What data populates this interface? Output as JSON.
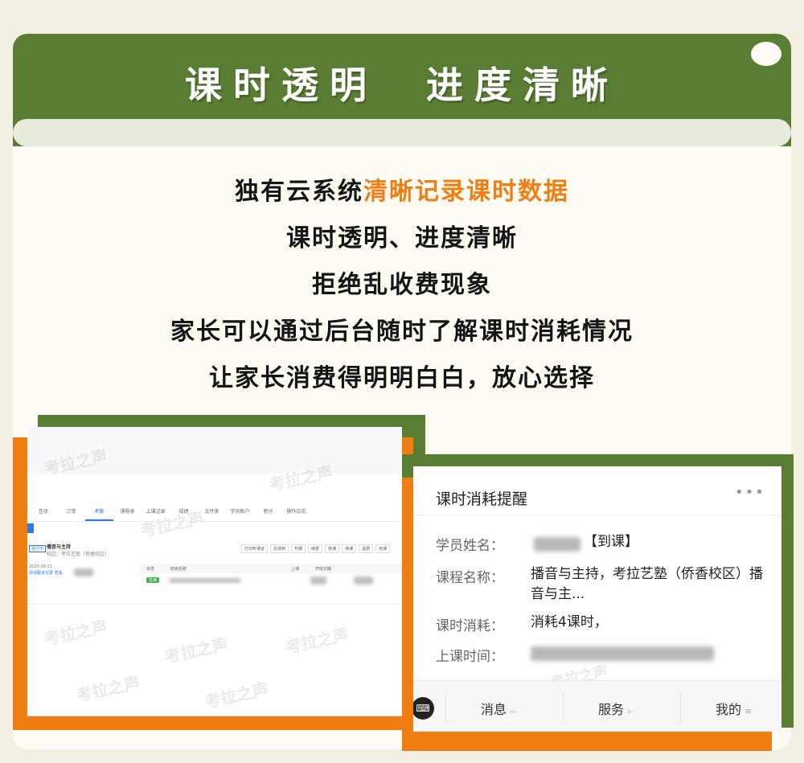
{
  "header": {
    "title": "课时透明  进度清晰"
  },
  "intro": {
    "line1_a": "独有云系统",
    "line1_b": "清晰记录课时数据",
    "line2": "课时透明、进度清晰",
    "line3": "拒绝乱收费现象",
    "line4": "家长可以通过后台随时了解课时消耗情况",
    "line5": "让家长消费得明明白白，放心选择"
  },
  "colors": {
    "brand_green": "#5a7d34",
    "accent_orange": "#f07e12",
    "background": "#f4efe3"
  },
  "watermark": {
    "text": "考拉之声"
  },
  "admin_screenshot": {
    "tabs": [
      "互动",
      "订单",
      "考勤",
      "课程表",
      "上课记录",
      "成绩",
      "文件夹",
      "学员账户",
      "积分",
      "操作日志"
    ],
    "course_title": "播音与主持",
    "course_sub": "校区：考拉艺塾（侨香校区）",
    "status_tag": "进行中",
    "buttons": [
      "打印听课证",
      "反馈到",
      "升期",
      "续费",
      "转课",
      "停课",
      "退费",
      "结课"
    ],
    "table_headers": [
      "状态",
      "班级名称",
      "上课",
      "开班日期"
    ],
    "row_status": "在读",
    "left_info": "2023-08-21",
    "left_link": "添加跟进记录",
    "left_link2": "查看"
  },
  "notice": {
    "title": "课时消耗提醒",
    "more_icon": "more-icon",
    "fields": {
      "student_label": "学员姓名：",
      "student_value": "【到课】",
      "course_label": "课程名称：",
      "course_value": "播音与主持，考拉艺塾（侨香校区）播音与主...",
      "consume_label": "课时消耗：",
      "consume_value": "消耗4课时，",
      "time_label": "上课时间："
    },
    "tabbar": {
      "keyboard_icon": "keyboard-icon",
      "tab1": "消息",
      "tab2": "服务",
      "tab3": "我的"
    }
  }
}
